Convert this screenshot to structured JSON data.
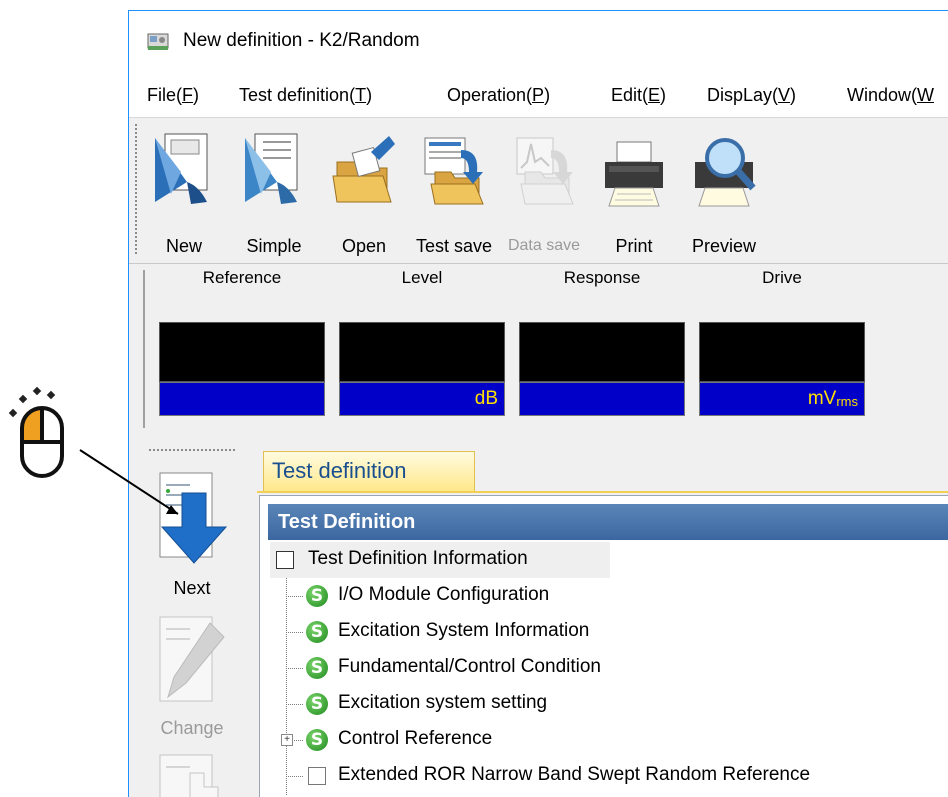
{
  "window": {
    "title": "New definition - K2/Random"
  },
  "menu": [
    {
      "label": "File(F)",
      "key": "F",
      "pre": "File(",
      "post": ")"
    },
    {
      "label": "Test definition(T)",
      "key": "T",
      "pre": "Test definition(",
      "post": ")"
    },
    {
      "label": "Operation(P)",
      "key": "P",
      "pre": "Operation(",
      "post": ")"
    },
    {
      "label": "Edit(E)",
      "key": "E",
      "pre": "Edit(",
      "post": ")"
    },
    {
      "label": "DispLay(V)",
      "key": "V",
      "pre": "DispLay(",
      "post": ")"
    },
    {
      "label": "Window(W",
      "key": "W",
      "pre": "Window(",
      "post": ""
    }
  ],
  "toolbar": {
    "new": "New",
    "simple": "Simple",
    "open": "Open",
    "test_save": "Test save",
    "data_save": "Data save",
    "print": "Print",
    "preview": "Preview"
  },
  "monitors": [
    {
      "label": "Reference",
      "unit": "",
      "sub": ""
    },
    {
      "label": "Level",
      "unit": "dB",
      "sub": ""
    },
    {
      "label": "Response",
      "unit": "",
      "sub": ""
    },
    {
      "label": "Drive",
      "unit": "mV",
      "sub": "rms"
    }
  ],
  "sidebar": {
    "next": "Next",
    "change": "Change"
  },
  "tab": {
    "label": "Test definition"
  },
  "panel": {
    "header": "Test Definition"
  },
  "tree": [
    "Test Definition Information",
    "I/O Module Configuration",
    "Excitation System Information",
    "Fundamental/Control Condition",
    "Excitation system setting",
    "Control Reference",
    "Extended ROR Narrow Band Swept Random Reference"
  ],
  "colors": {
    "unit_bg": "#0000c8",
    "unit_text": "#ffe000",
    "panel_header": "#4a76ac",
    "tab_text": "#1a4f8f"
  }
}
